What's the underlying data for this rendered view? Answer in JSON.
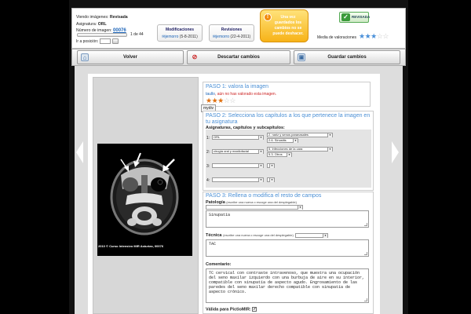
{
  "info": {
    "viewing_label": "Viendo imágenes:",
    "viewing_value": "Revisada",
    "subject_label": "Asignatura:",
    "subject_value": "ORL",
    "number_label": "Número de imagen:",
    "number_value": "00076",
    "position_text": "1 de 44",
    "goto_label": "Ir a posición:"
  },
  "modifications": {
    "title": "Modificaciones",
    "user": "jemorro",
    "date": "(5-8-2011)"
  },
  "revisions": {
    "title": "Revisiones",
    "user": "jemorro",
    "date": "(22-4-2011)"
  },
  "warning": {
    "line1": "Una vez",
    "line2": "guardados los",
    "line3": "cambios no se",
    "line4": "puede deshacer."
  },
  "status_badge": "REVISADA",
  "ratings": {
    "label": "Media de valoraciones",
    "value": 3,
    "max": 5
  },
  "buttons": {
    "back": "Volver",
    "discard": "Descartar cambios",
    "save": "Guardar cambios"
  },
  "image": {
    "caption": "2010 © Curso Intensivo MIR Asturias, 00076"
  },
  "step1": {
    "title": "PASO 1: valora la imagen",
    "user": "taullo",
    "note": ", aún no has valorado esta imagen.",
    "stars": 3,
    "max": 5,
    "tooltip": "mydiv"
  },
  "step2": {
    "title": "PASO 2: Selecciona los capítulos a los que pertenece la imagen en tu asignatura",
    "subtitle": "Asignaturas, capítulos y subcapítulos:",
    "rows": [
      {
        "n": "1:",
        "subject": "ORL",
        "chapter": "2. nariz y senos paranasales",
        "subchapter": "2.6. Sinusitis"
      },
      {
        "n": "2:",
        "subject": "cirugía oral y maxilofacial",
        "chapter": "5. Infecciones de la cara",
        "subchapter": "5.3. Otros"
      },
      {
        "n": "3:",
        "subject": "",
        "chapter": "",
        "subchapter": ""
      },
      {
        "n": "4:",
        "subject": "",
        "chapter": "",
        "subchapter": ""
      }
    ]
  },
  "step3": {
    "title": "PASO 3: Rellena o modifica el resto de campos",
    "pathology_label": "Patología",
    "pathology_hint": "(escribe una nueva o escoge una del desplegable)",
    "pathology_value": "Sinupatía",
    "technique_label": "Técnica",
    "technique_hint": "(escribe una nueva o escoge una del desplegable)",
    "technique_value": "TAC",
    "comment_label": "Comentario:",
    "comment_value": "TC cervical con contraste intravenoso, que muestra una ocupación del seno maxilar izquierdo con una burbuja de aire en su interior, compatible con sinupatía de aspecto agudo. Engrosamiento de las paredes del seno maxilar derecho compatible con sinupatía de aspecto crónico.",
    "valid_label": "Válida para PictioMIR:",
    "valid_checked": true
  },
  "colors": {
    "link": "#1a63b8",
    "step": "#4a8fd5",
    "warning": "#f7b318",
    "ok": "#3a9a3a"
  }
}
